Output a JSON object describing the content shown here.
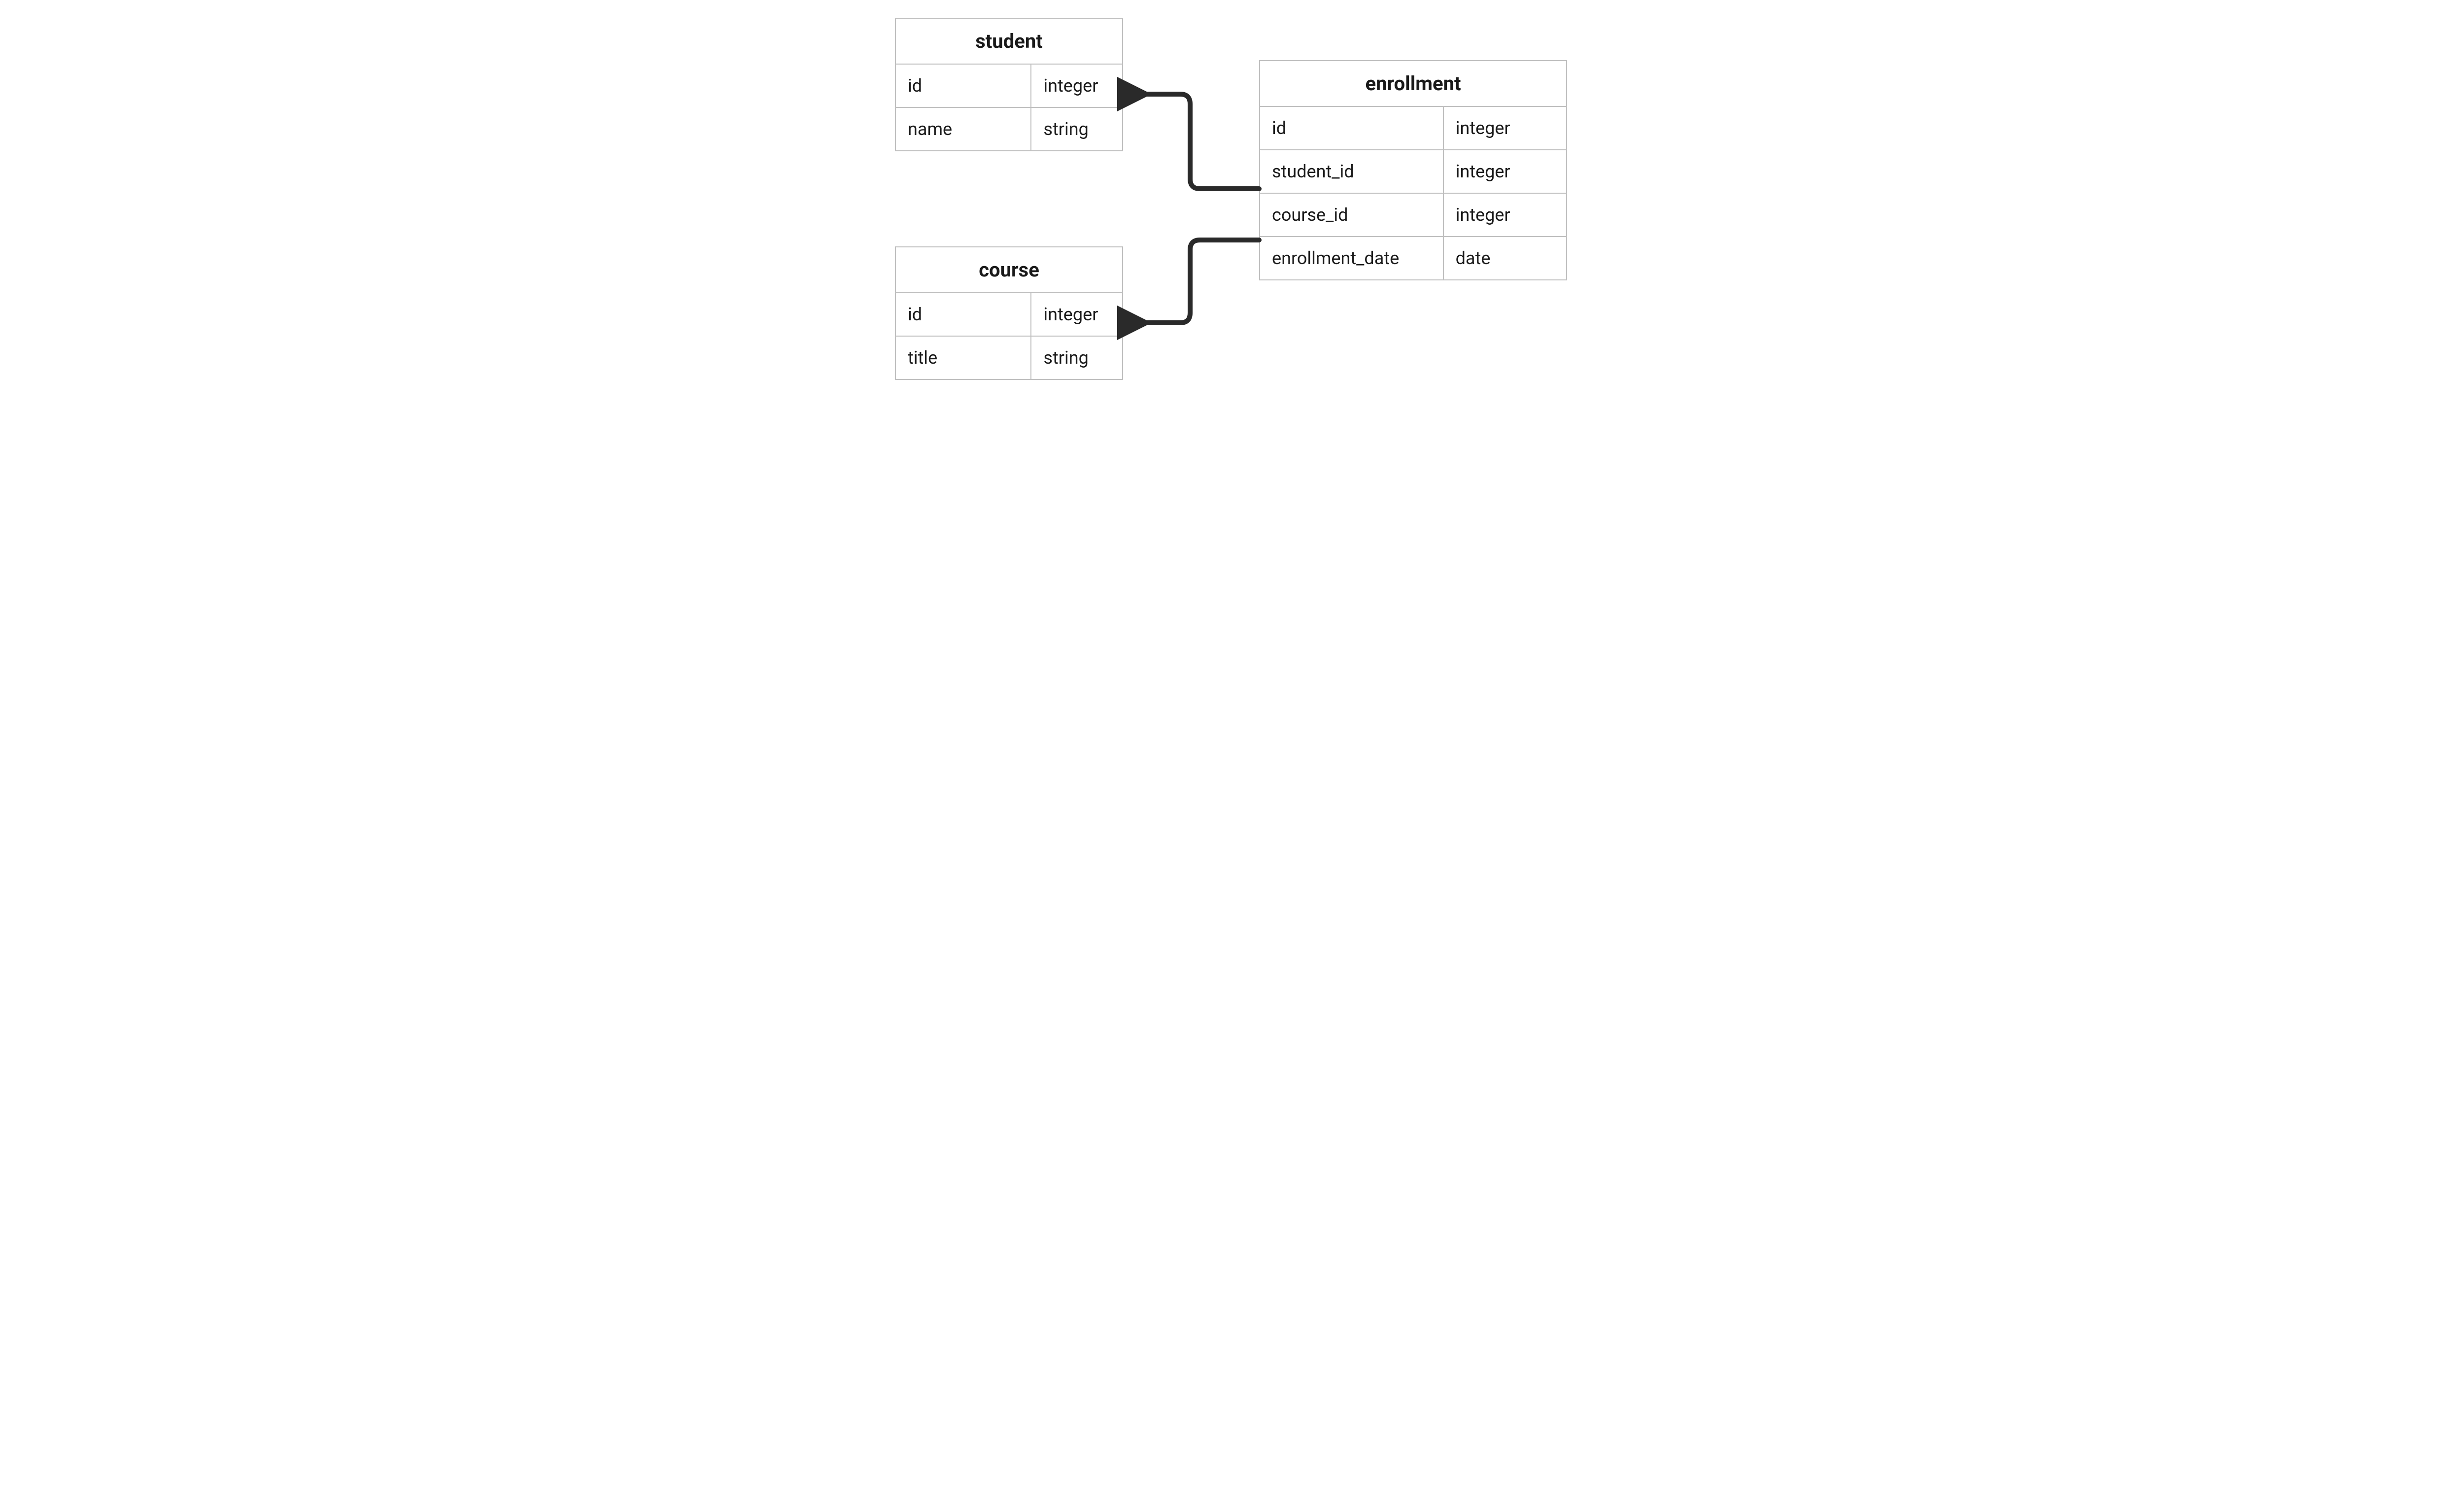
{
  "entities": {
    "student": {
      "title": "student",
      "columns": [
        {
          "name": "id",
          "type": "integer"
        },
        {
          "name": "name",
          "type": "string"
        }
      ]
    },
    "course": {
      "title": "course",
      "columns": [
        {
          "name": "id",
          "type": "integer"
        },
        {
          "name": "title",
          "type": "string"
        }
      ]
    },
    "enrollment": {
      "title": "enrollment",
      "columns": [
        {
          "name": "id",
          "type": "integer"
        },
        {
          "name": "student_id",
          "type": "integer"
        },
        {
          "name": "course_id",
          "type": "integer"
        },
        {
          "name": "enrollment_date",
          "type": "date"
        }
      ]
    }
  },
  "relationships": [
    {
      "from": "enrollment.student_id",
      "to": "student.id"
    },
    {
      "from": "enrollment.course_id",
      "to": "course.id"
    }
  ]
}
